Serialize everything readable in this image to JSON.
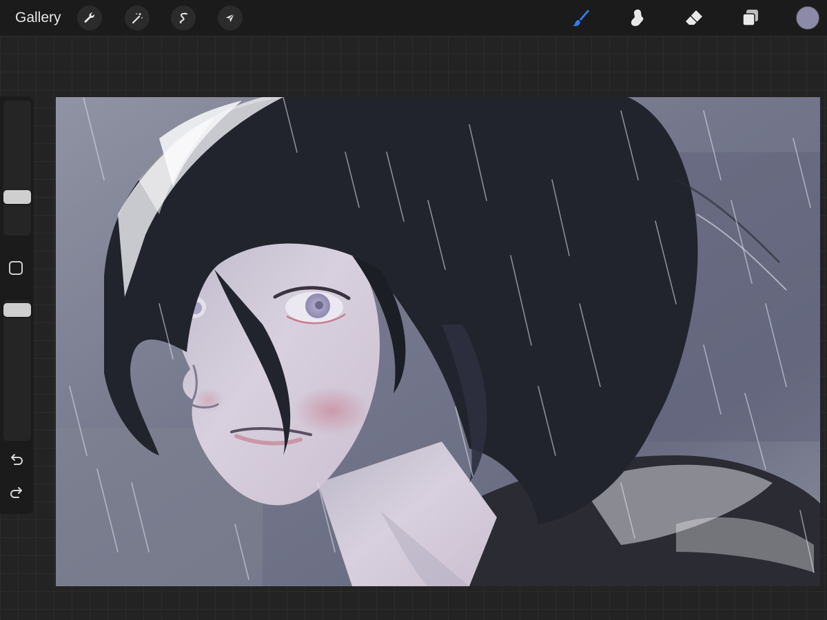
{
  "topbar": {
    "gallery_label": "Gallery",
    "left_tools": [
      "wrench-icon",
      "magic-wand-icon",
      "selection-icon",
      "transform-arrow-icon"
    ],
    "right_tools": [
      "brush-icon",
      "smudge-icon",
      "eraser-icon",
      "layers-icon"
    ],
    "active_tool": "brush",
    "current_color": "#8c8aa8"
  },
  "sidebar": {
    "brush_size_level": 0.25,
    "brush_opacity_level": 1.0
  },
  "colors": {
    "accent": "#2f7df7",
    "hair": "#22242d",
    "skin": "#d8d0de",
    "background": "#7a7d8f"
  }
}
